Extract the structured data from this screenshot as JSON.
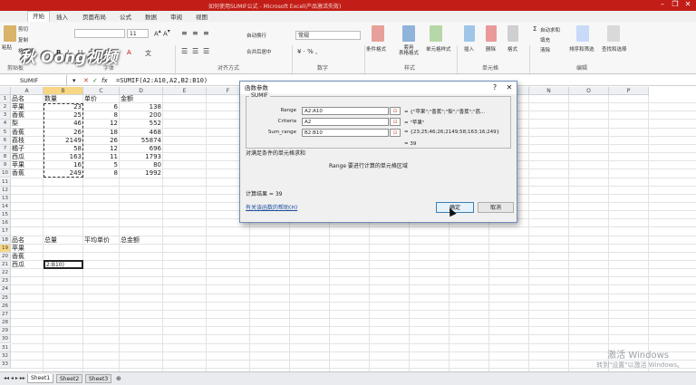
{
  "window": {
    "title": "如何使用SUMIF公式 - Microsoft Excel(产品激活失败)"
  },
  "ribbon_tabs": [
    "文件",
    "开始",
    "插入",
    "页面布局",
    "公式",
    "数据",
    "审阅",
    "视图"
  ],
  "ribbon": {
    "font_name": "",
    "font_size": "11",
    "wrap_text": "自动换行",
    "merge_center": "合并后居中",
    "number_format": "常规",
    "cond_format": "条件格式",
    "table_format": "套用\n表格格式",
    "cell_style": "单元格样式",
    "insert": "插入",
    "delete": "删除",
    "format": "格式",
    "autosum": "自动求和",
    "fill": "填充",
    "clear": "清除",
    "sort_filter": "排序和筛选",
    "find_select": "查找和选择",
    "paste": "粘贴",
    "cut": "剪切",
    "copy": "复制",
    "format_painter": "格式刷",
    "groups": [
      "剪贴板",
      "字体",
      "对齐方式",
      "数字",
      "样式",
      "单元格",
      "编辑"
    ],
    "logo": "秋 Oong视频"
  },
  "formula_bar": {
    "name_box": "SUMIF",
    "formula": "=SUMIF(A2:A10,A2,B2:B10)"
  },
  "columns": [
    "A",
    "B",
    "C",
    "D",
    "E",
    "F",
    "G",
    "H",
    "I",
    "J",
    "K",
    "L",
    "M",
    "N",
    "O",
    "P"
  ],
  "rows": [
    "1",
    "2",
    "3",
    "4",
    "5",
    "6",
    "7",
    "8",
    "9",
    "10",
    "11",
    "12",
    "13",
    "14",
    "15",
    "16",
    "17",
    "18",
    "19",
    "20",
    "21",
    "22",
    "23",
    "24",
    "25",
    "26",
    "27",
    "28",
    "29",
    "30",
    "31",
    "32",
    "33"
  ],
  "table": {
    "headers": [
      "品名",
      "数量",
      "单价",
      "金额"
    ],
    "rows": [
      [
        "苹果",
        "23",
        "6",
        "138"
      ],
      [
        "香蕉",
        "25",
        "8",
        "200"
      ],
      [
        "梨",
        "46",
        "12",
        "552"
      ],
      [
        "香蕉",
        "26",
        "18",
        "468"
      ],
      [
        "荔枝",
        "2149",
        "26",
        "55874"
      ],
      [
        "橘子",
        "58",
        "12",
        "696"
      ],
      [
        "西瓜",
        "163",
        "11",
        "1793"
      ],
      [
        "苹果",
        "16",
        "5",
        "80"
      ],
      [
        "香蕉",
        "249",
        "8",
        "1992"
      ]
    ]
  },
  "summary": {
    "headers": [
      "品名",
      "总量",
      "平均单价",
      "总金额"
    ],
    "items": [
      "苹果",
      "香蕉",
      "西瓜"
    ],
    "editing": "2:B10)"
  },
  "sheets": [
    "Sheet1",
    "Sheet2",
    "Sheet3"
  ],
  "dialog": {
    "title": "函数参数",
    "function": "SUMIF",
    "args": [
      {
        "label": "Range",
        "value": "A2:A10",
        "result": "= {\"苹果\";\"香蕉\";\"梨\";\"香蕉\";\"荔..."
      },
      {
        "label": "Criteria",
        "value": "A2",
        "result": "= \"苹果\""
      },
      {
        "label": "Sum_range",
        "value": "B2:B10",
        "result": "= {23;25;46;26;2149;58;163;16;249}"
      }
    ],
    "result_eq": "= 39",
    "description": "对满足条件的单元格求和",
    "arg_help": "Range  要进行计算的单元格区域",
    "calc_result": "计算结果 = 39",
    "help_link": "有关该函数的帮助(H)",
    "ok": "确定",
    "cancel": "取消"
  },
  "watermark": {
    "line1": "激活 Windows",
    "line2": "转到\"设置\"以激活 Windows。"
  }
}
